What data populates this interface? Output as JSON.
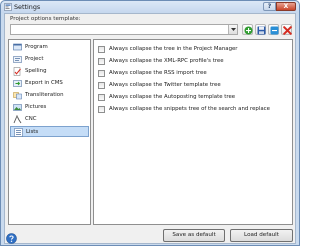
{
  "window": {
    "title": "Settings",
    "help_label": "?",
    "close_label": "X"
  },
  "template": {
    "label": "Project options template:",
    "value": ""
  },
  "sidebar": {
    "items": [
      {
        "label": "Program",
        "icon": "program-icon"
      },
      {
        "label": "Project",
        "icon": "project-icon"
      },
      {
        "label": "Spelling",
        "icon": "spelling-icon"
      },
      {
        "label": "Export in CMS",
        "icon": "export-cms-icon"
      },
      {
        "label": "Transliteration",
        "icon": "transliteration-icon"
      },
      {
        "label": "Pictures",
        "icon": "pictures-icon"
      },
      {
        "label": "CNC",
        "icon": "cnc-icon"
      },
      {
        "label": "Lists",
        "icon": "lists-icon",
        "selected": true
      }
    ]
  },
  "options": [
    {
      "label": "Always collapse the tree in the Project Manager",
      "checked": false
    },
    {
      "label": "Always collapse the XML-RPC profile's tree",
      "checked": false
    },
    {
      "label": "Always collapse the RSS import tree",
      "checked": false
    },
    {
      "label": "Always collapse the Twitter template tree",
      "checked": false
    },
    {
      "label": "Always collapse the Autoposting template tree",
      "checked": false
    },
    {
      "label": "Always collapse the snippets tree of the search and replace",
      "checked": false
    }
  ],
  "buttons": {
    "save_default": "Save as default",
    "load_default": "Load  default"
  },
  "colors": {
    "accent": "#7da2ce",
    "selection": "#c5ddf7",
    "add": "#2e9b2e",
    "save": "#2b5aa8",
    "duplicate": "#2a8fd6",
    "delete": "#d62a1f"
  }
}
